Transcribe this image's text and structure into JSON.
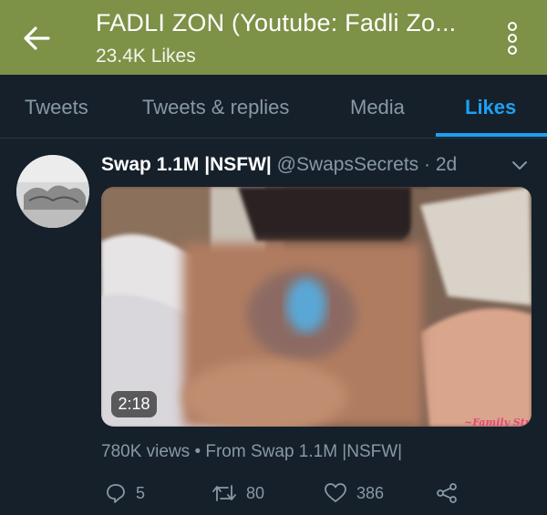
{
  "header": {
    "title": "FADLI ZON (Youtube: Fadli Zo...",
    "subtitle": "23.4K Likes",
    "back_icon": "arrow-left-icon",
    "more_icon": "more-vertical-icon"
  },
  "tabs": [
    {
      "label": "Tweets",
      "active": false
    },
    {
      "label": "Tweets & replies",
      "active": false
    },
    {
      "label": "Media",
      "active": false
    },
    {
      "label": "Likes",
      "active": true
    }
  ],
  "tweet": {
    "author_name": "Swap 1.1M |NSFW|",
    "handle": "@SwapsSecrets",
    "time": "2d",
    "media": {
      "duration": "2:18",
      "watermark": "~Family Str"
    },
    "views_line": "780K views • From Swap 1.1M |NSFW|",
    "actions": {
      "replies": "5",
      "retweets": "80",
      "likes": "386"
    }
  },
  "colors": {
    "header_bg": "#7d9147",
    "background": "#15202b",
    "accent": "#1da1f2",
    "muted_text": "#8899a6"
  }
}
